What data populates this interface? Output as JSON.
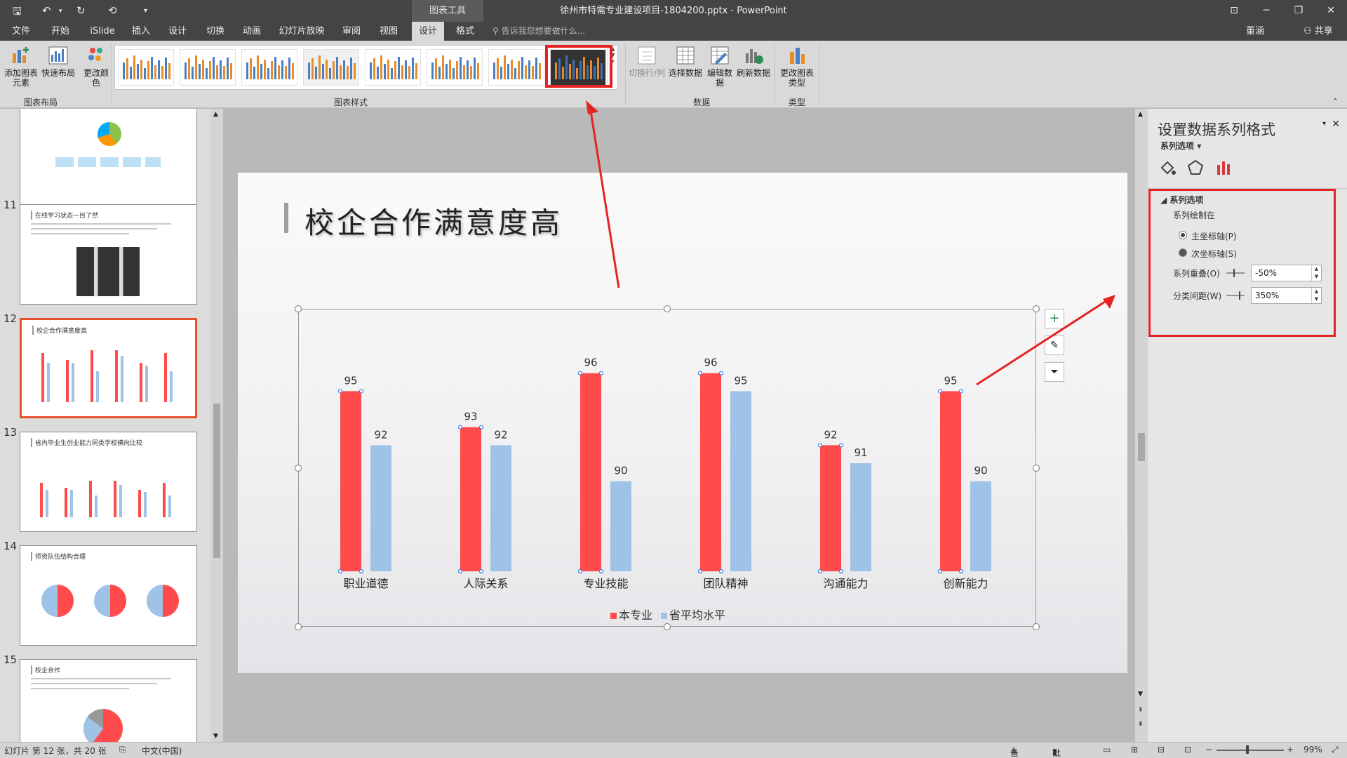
{
  "window": {
    "title": "徐州市特需专业建设项目-1804200.pptx - PowerPoint",
    "context_tab_group": "图表工具"
  },
  "tabs": [
    "文件",
    "开始",
    "iSlide",
    "插入",
    "设计",
    "切换",
    "动画",
    "幻灯片放映",
    "审阅",
    "视图",
    "设计",
    "格式"
  ],
  "active_tab_index": 10,
  "tell_me": "告诉我您想要做什么...",
  "user": "董涵",
  "share": "共享",
  "ribbon": {
    "add_element": "添加图表元素",
    "quick_layout": "快速布局",
    "change_color": "更改颜色",
    "group_layout": "图表布局",
    "group_styles": "图表样式",
    "switch_row_col": "切换行/列",
    "select_data": "选择数据",
    "edit_data": "编辑数据",
    "refresh_data": "刷新数据",
    "group_data": "数据",
    "change_type": "更改图表类型",
    "group_type": "类型"
  },
  "thumbnails": [
    {
      "num": "",
      "title": "",
      "kind": "donut"
    },
    {
      "num": "11",
      "title": "在线学习状态一目了然",
      "kind": "phones"
    },
    {
      "num": "12",
      "title": "校企合作满意度高",
      "kind": "bars",
      "selected": true
    },
    {
      "num": "13",
      "title": "省内毕业生创业能力同类学校横向比较",
      "kind": "bars2"
    },
    {
      "num": "14",
      "title": "师资队伍结构合理",
      "kind": "pies"
    },
    {
      "num": "15",
      "title": "校企合作",
      "kind": "pie1"
    }
  ],
  "slide": {
    "title": "校企合作满意度高"
  },
  "chart_data": {
    "type": "bar",
    "categories": [
      "职业道德",
      "人际关系",
      "专业技能",
      "团队精神",
      "沟通能力",
      "创新能力"
    ],
    "series": [
      {
        "name": "本专业",
        "color": "#ff4b4b",
        "values": [
          95,
          93,
          96,
          96,
          92,
          95
        ]
      },
      {
        "name": "省平均水平",
        "color": "#9fc3e7",
        "values": [
          92,
          92,
          90,
          95,
          91,
          90
        ]
      }
    ],
    "ylim": [
      85,
      97
    ],
    "legend": "bottom",
    "grid": false
  },
  "format_pane": {
    "title": "设置数据系列格式",
    "subtitle": "系列选项",
    "section": "系列选项",
    "plot_on": "系列绘制在",
    "primary_axis": "主坐标轴(P)",
    "secondary_axis": "次坐标轴(S)",
    "overlap_label": "系列重叠(O)",
    "overlap_value": "-50%",
    "gap_label": "分类间距(W)",
    "gap_value": "350%"
  },
  "status": {
    "slide_info": "幻灯片 第 12 张，共 20 张",
    "language": "中文(中国)",
    "notes": "备注",
    "comments": "批注",
    "zoom": "99%"
  }
}
